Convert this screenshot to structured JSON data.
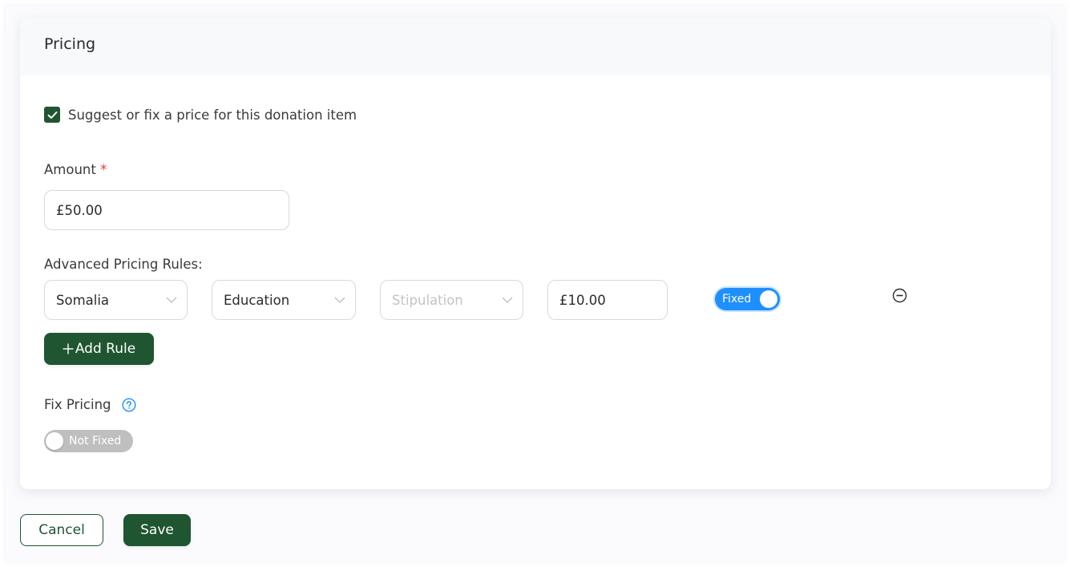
{
  "card": {
    "title": "Pricing"
  },
  "suggest_price": {
    "checked": true,
    "label": "Suggest or fix a price for this donation item"
  },
  "amount": {
    "label": "Amount",
    "required_marker": "*",
    "value": "£50.00"
  },
  "advanced_rules": {
    "label": "Advanced Pricing Rules:",
    "rules": [
      {
        "country": "Somalia",
        "category": "Education",
        "stipulation_placeholder": "Stipulation",
        "stipulation": "",
        "amount": "£10.00",
        "fixed_toggle": {
          "on": true,
          "label": "Fixed"
        },
        "remove_icon": "minus-circle-icon"
      }
    ],
    "add_rule_label": "Add Rule",
    "add_rule_icon": "plus-icon"
  },
  "fix_pricing": {
    "label": "Fix Pricing",
    "help_icon": "question-circle-icon",
    "toggle": {
      "on": false,
      "label": "Not Fixed"
    }
  },
  "footer": {
    "cancel_label": "Cancel",
    "save_label": "Save"
  },
  "colors": {
    "brand_green": "#1f5530",
    "toggle_on_blue": "#1e8fff",
    "toggle_off_gray": "#bfbfbf",
    "required_red": "#e53935",
    "help_icon_blue": "#1e8fff"
  }
}
